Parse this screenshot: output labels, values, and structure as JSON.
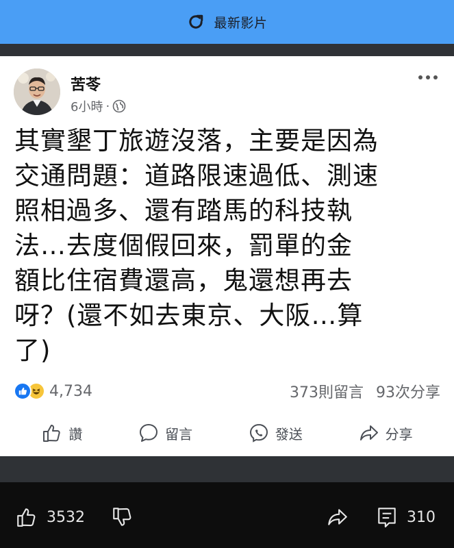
{
  "header": {
    "title": "最新影片",
    "icon": "refresh-icon"
  },
  "post": {
    "author": "苦苓",
    "time": "6小時",
    "separator": "·",
    "privacy_icon": "globe-icon",
    "text_lines": [
      "其實墾丁旅遊沒落，主要是因為",
      "交通問題：道路限速過低、測速",
      "照相過多、還有踏馬的科技執",
      "法…去度個假回來，罰單的金",
      "額比住宿費還高，鬼還想再去",
      "呀？(還不如去東京、大阪…算",
      "了)"
    ],
    "reaction_count": "4,734",
    "comments": "373則留言",
    "shares": "93次分享",
    "reaction_icons": [
      "like-icon",
      "haha-icon"
    ]
  },
  "actions": {
    "like": "讚",
    "comment": "留言",
    "send": "發送",
    "share": "分享"
  },
  "bottom_bar": {
    "likes": "3532",
    "comments": "310"
  },
  "colors": {
    "header_bg": "#4a9ef5",
    "like_blue": "#1877f2",
    "haha_yellow": "#f7c53a",
    "dark_bg": "#0d0d0d"
  }
}
